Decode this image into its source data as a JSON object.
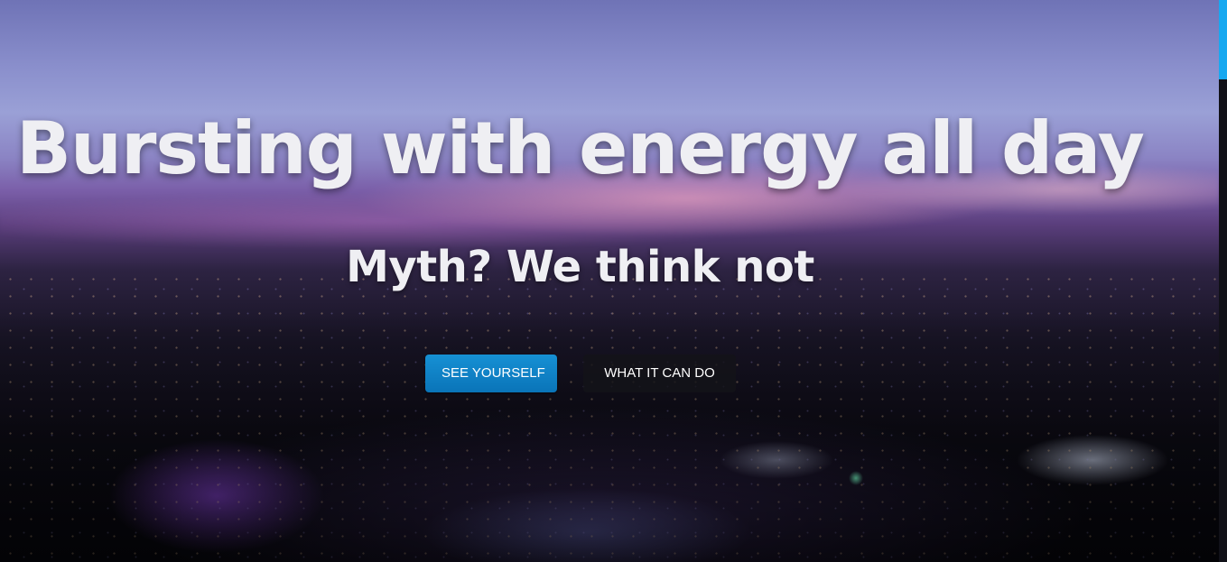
{
  "hero": {
    "headline": "Bursting with energy all day",
    "subheadline": "Myth? We think not",
    "buttons": {
      "primary_label": "SEE YOURSELF",
      "secondary_label": "WHAT IT CAN DO"
    }
  },
  "colors": {
    "primary_button": "#0a7fc4",
    "secondary_button": "#141418",
    "text": "#efeff3",
    "scrollbar_thumb": "#18a8f0"
  },
  "scroll": {
    "position_fraction": 0
  }
}
